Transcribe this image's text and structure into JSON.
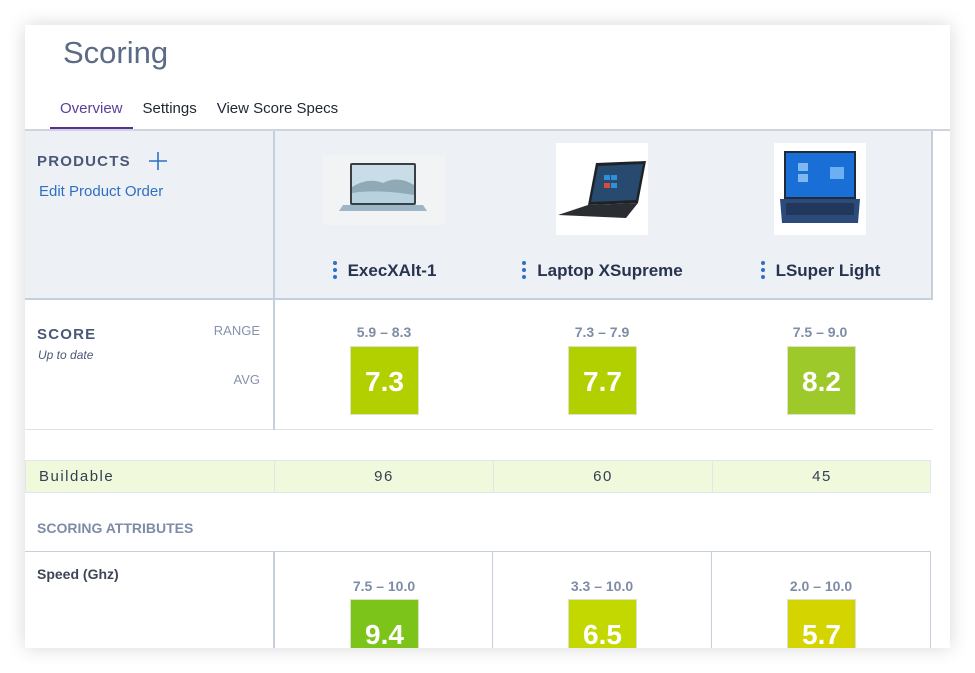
{
  "page": {
    "title": "Scoring"
  },
  "tabs": [
    {
      "label": "Overview",
      "active": true
    },
    {
      "label": "Settings",
      "active": false
    },
    {
      "label": "View Score Specs",
      "active": false
    }
  ],
  "products_header": {
    "label": "PRODUCTS",
    "add_icon": "plus-icon",
    "edit_order_link": "Edit Product Order"
  },
  "products": [
    {
      "name": "ExecXAlt-1",
      "image": "laptop-light-blue-image",
      "menu_icon": "kebab-icon"
    },
    {
      "name": "Laptop XSupreme",
      "image": "laptop-black-image",
      "menu_icon": "kebab-icon"
    },
    {
      "name": "LSuper Light",
      "image": "laptop-navy-image",
      "menu_icon": "kebab-icon"
    }
  ],
  "score": {
    "label": "SCORE",
    "status": "Up to date",
    "range_label": "RANGE",
    "avg_label": "AVG",
    "values": [
      {
        "range": "5.9 – 8.3",
        "avg": "7.3",
        "color": "#b2d000"
      },
      {
        "range": "7.3 – 7.9",
        "avg": "7.7",
        "color": "#b2d000"
      },
      {
        "range": "7.5 – 9.0",
        "avg": "8.2",
        "color": "#9ec92a"
      }
    ]
  },
  "buildable": {
    "label": "Buildable",
    "values": [
      "96",
      "60",
      "45"
    ]
  },
  "scoring_attributes": {
    "title": "SCORING ATTRIBUTES",
    "rows": [
      {
        "name": "Speed (Ghz)",
        "values": [
          {
            "range": "7.5 – 10.0",
            "score": "9.4",
            "color": "#7dc41a"
          },
          {
            "range": "3.3 – 10.0",
            "score": "6.5",
            "color": "#c2d800"
          },
          {
            "range": "2.0 – 10.0",
            "score": "5.7",
            "color": "#d4d400"
          }
        ]
      }
    ]
  }
}
